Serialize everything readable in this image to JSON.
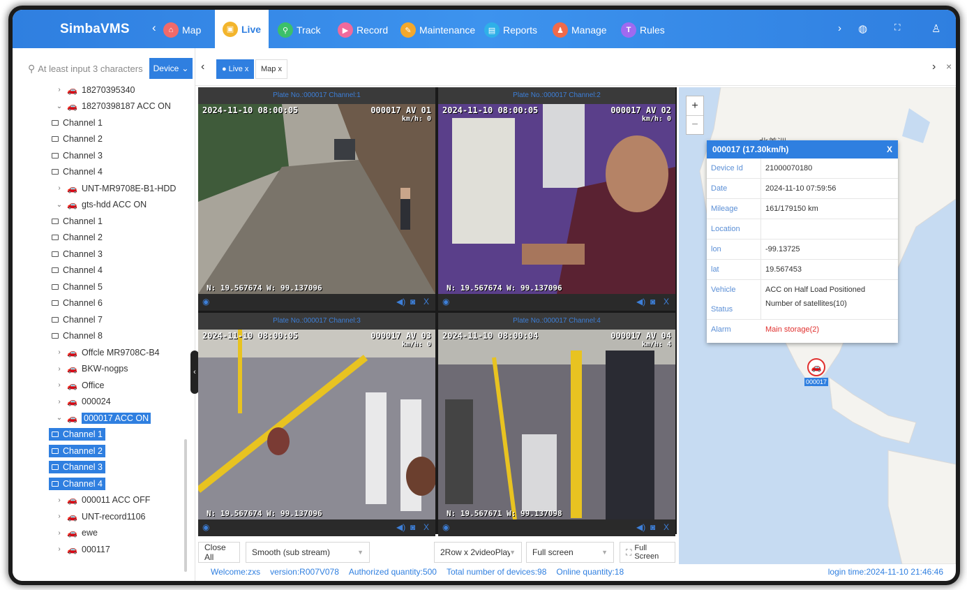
{
  "app": {
    "brand": "SimbaVMS"
  },
  "nav": {
    "items": [
      {
        "label": "Map",
        "color": "#f06a6a"
      },
      {
        "label": "Live",
        "color": "#f3b52c"
      },
      {
        "label": "Track",
        "color": "#3cc06a"
      },
      {
        "label": "Record",
        "color": "#f06a9c"
      },
      {
        "label": "Maintenance",
        "color": "#f3a82c"
      },
      {
        "label": "Reports",
        "color": "#2fb0e8"
      },
      {
        "label": "Manage",
        "color": "#f06a4a"
      },
      {
        "label": "Rules",
        "color": "#a06af0"
      }
    ],
    "active": "Live"
  },
  "search": {
    "placeholder": "At least input 3 characters",
    "device_button": "Device"
  },
  "tree": [
    {
      "type": "device",
      "label": "18270395340",
      "expanded": false,
      "status": "offline"
    },
    {
      "type": "device",
      "label": "18270398187 ACC ON",
      "expanded": true,
      "status": "online"
    },
    {
      "type": "channel",
      "label": "Channel 1"
    },
    {
      "type": "channel",
      "label": "Channel 2"
    },
    {
      "type": "channel",
      "label": "Channel 3"
    },
    {
      "type": "channel",
      "label": "Channel 4"
    },
    {
      "type": "device",
      "label": "UNT-MR9708E-B1-HDD",
      "expanded": false,
      "status": "offline"
    },
    {
      "type": "device",
      "label": "gts-hdd ACC ON",
      "expanded": true,
      "status": "online"
    },
    {
      "type": "channel",
      "label": "Channel 1"
    },
    {
      "type": "channel",
      "label": "Channel 2"
    },
    {
      "type": "channel",
      "label": "Channel 3"
    },
    {
      "type": "channel",
      "label": "Channel 4"
    },
    {
      "type": "channel",
      "label": "Channel 5"
    },
    {
      "type": "channel",
      "label": "Channel 6"
    },
    {
      "type": "channel",
      "label": "Channel 7"
    },
    {
      "type": "channel",
      "label": "Channel 8"
    },
    {
      "type": "device",
      "label": "Offcle MR9708C-B4",
      "expanded": false,
      "status": "offline"
    },
    {
      "type": "device",
      "label": "BKW-nogps",
      "expanded": false,
      "status": "offline"
    },
    {
      "type": "device",
      "label": "Office",
      "expanded": false,
      "status": "offline"
    },
    {
      "type": "device",
      "label": "000024",
      "expanded": false,
      "status": "offline"
    },
    {
      "type": "device",
      "label": "000017 ACC ON",
      "expanded": true,
      "status": "alarm",
      "selected": true
    },
    {
      "type": "channel",
      "label": "Channel 1",
      "selected": true
    },
    {
      "type": "channel",
      "label": "Channel 2",
      "selected": true
    },
    {
      "type": "channel",
      "label": "Channel 3",
      "selected": true
    },
    {
      "type": "channel",
      "label": "Channel 4",
      "selected": true
    },
    {
      "type": "device",
      "label": "000011 ACC OFF",
      "expanded": false,
      "status": "alarm"
    },
    {
      "type": "device",
      "label": "UNT-record1106",
      "expanded": false,
      "status": "offline"
    },
    {
      "type": "device",
      "label": "ewe",
      "expanded": false,
      "status": "offline"
    },
    {
      "type": "device",
      "label": "000117",
      "expanded": false,
      "status": "offline"
    }
  ],
  "tabs": [
    {
      "label": "Live x",
      "active": true
    },
    {
      "label": "Map x",
      "active": false
    }
  ],
  "videos": [
    {
      "title": "Plate No.:000017 Channel:1",
      "timestamp": "2024-11-10 08:00:05",
      "osd_right": "000017 AV 01",
      "speed": "km/h:      0",
      "gps": "N: 19.567674 W: 99.137096"
    },
    {
      "title": "Plate No.:000017 Channel:2",
      "timestamp": "2024-11-10 08:00:05",
      "osd_right": "000017 AV 02",
      "speed": "km/h:      0",
      "gps": "N: 19.567674 W: 99.137096"
    },
    {
      "title": "Plate No.:000017 Channel:3",
      "timestamp": "2024-11-10 08:00:05",
      "osd_right": "000017 AV 03",
      "speed": "km/h:      0",
      "gps": "N: 19.567674 W: 99.137096"
    },
    {
      "title": "Plate No.:000017 Channel:4",
      "timestamp": "2024-11-10 08:00:04",
      "osd_right": "000017 AV 04",
      "speed": "km/h:      4",
      "gps": "N: 19.567671 W: 99.137098"
    }
  ],
  "controls": {
    "close_all": "Close All",
    "stream": "Smooth (sub stream)",
    "layout": "2Row x 2videoPlay",
    "screen_mode": "Full screen",
    "full_screen_button": "Full Screen"
  },
  "map": {
    "region_label": "北美洲",
    "popup": {
      "title": "000017 (17.30km/h)",
      "close": "X",
      "rows": [
        {
          "key": "Device Id",
          "value": "21000070180"
        },
        {
          "key": "Date",
          "value": "2024-11-10 07:59:56"
        },
        {
          "key": "Mileage",
          "value": "161/179150 km"
        },
        {
          "key": "Location",
          "value": ""
        },
        {
          "key": "lon",
          "value": "-99.13725"
        },
        {
          "key": "lat",
          "value": "19.567453"
        },
        {
          "key": "Vehicle Status",
          "value": "ACC on Half Load Positioned Number of satellites(10)"
        },
        {
          "key": "Alarm",
          "value": "Main storage(2)"
        }
      ]
    },
    "marker_label": "000017"
  },
  "status": {
    "welcome": "Welcome:zxs",
    "version": "version:R007V078",
    "authorized": "Authorized quantity:500",
    "total": "Total number of devices:98",
    "online": "Online quantity:18",
    "login_time": "login time:2024-11-10 21:46:46"
  }
}
